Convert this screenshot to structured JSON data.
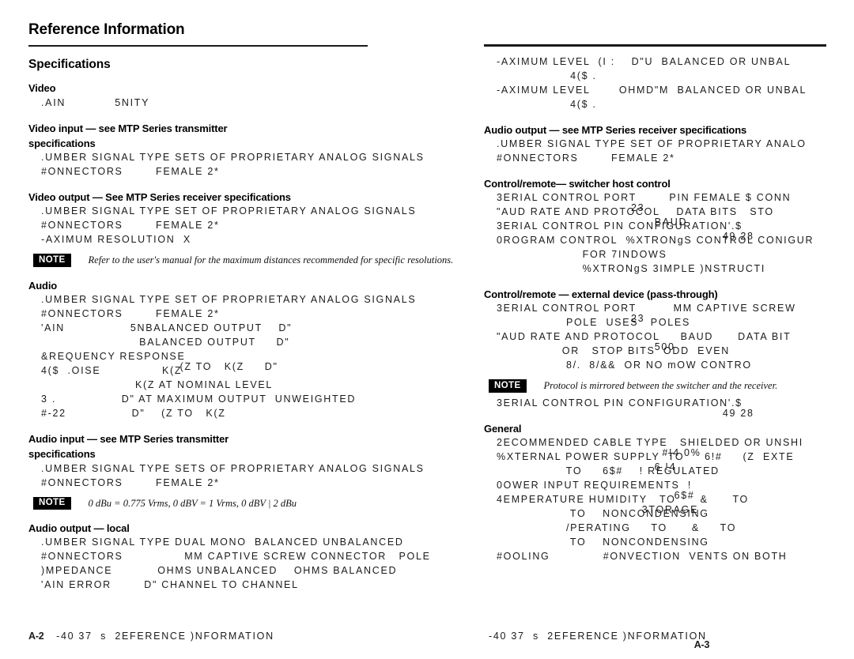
{
  "page": {
    "title": "Reference Information",
    "section_title": "Specifications"
  },
  "left_column": {
    "video": {
      "heading": "Video",
      "rows": [
        {
          "label": ".AIN",
          "value": "5NITY"
        }
      ]
    },
    "video_input": {
      "heading": "Video input — see MTP Series transmitter",
      "heading2": "specifications",
      "rows": [
        {
          "label": ".UMBER SIGNAL TYPE",
          "value": "SETS OF PROPRIETARY ANALOG SIGNALS"
        },
        {
          "label": "#ONNECTORS",
          "value": "FEMALE 2*"
        }
      ]
    },
    "video_output": {
      "heading": "Video output — See MTP Series receiver specifications",
      "rows": [
        {
          "label": ".UMBER SIGNAL TYPE",
          "value": "SET OF PROPRIETARY ANALOG SIGNALS"
        },
        {
          "label": "#ONNECTORS",
          "value": "FEMALE 2*"
        },
        {
          "label": "-AXIMUM RESOLUTION",
          "value": "X"
        }
      ],
      "note": "Refer to the user's manual for the maximum distances recommended for specific resolutions."
    },
    "audio": {
      "heading": "Audio",
      "rows": [
        {
          "label": ".UMBER SIGNAL TYPE",
          "value": "SET OF PROPRIETARY ANALOG SIGNALS"
        },
        {
          "label": "#ONNECTORS",
          "value": "FEMALE 2*"
        },
        {
          "label": "'AIN",
          "value": "5NBALANCED OUTPUT    D\""
        },
        {
          "label": "",
          "value": "BALANCED OUTPUT     D\""
        },
        {
          "label": "&REQUENCY RESPONSE",
          "value": "(Z TO   K(Z     D\""
        },
        {
          "label": "4($  .OISE",
          "value": "K(Z"
        },
        {
          "label": "",
          "value": "K(Z AT NOMINAL LEVEL"
        },
        {
          "label": "3 .",
          "value": "D\" AT MAXIMUM OUTPUT  UNWEIGHTED"
        },
        {
          "label": "#-22",
          "value": "D\"    (Z TO   K(Z"
        }
      ]
    },
    "audio_input": {
      "heading": "Audio input — see MTP Series transmitter",
      "heading2": "specifications",
      "rows": [
        {
          "label": ".UMBER SIGNAL TYPE",
          "value": "SETS OF PROPRIETARY ANALOG SIGNALS"
        },
        {
          "label": "#ONNECTORS",
          "value": "FEMALE 2*"
        }
      ],
      "note": "0 dBu = 0.775 Vrms, 0 dBV = 1 Vrms, 0 dBV | 2 dBu"
    },
    "audio_output_local": {
      "heading": "Audio output — local",
      "rows": [
        {
          "label": ".UMBER SIGNAL TYPE",
          "value": "DUAL MONO  BALANCED UNBALANCED"
        },
        {
          "label": "#ONNECTORS",
          "value": "MM CAPTIVE SCREW CONNECTOR   POLE"
        },
        {
          "label": ")MPEDANCE",
          "value": "OHMS UNBALANCED    OHMS BALANCED"
        },
        {
          "label": "'AIN ERROR",
          "value": "D\" CHANNEL TO CHANNEL"
        }
      ]
    }
  },
  "right_column": {
    "max_level": {
      "rows": [
        {
          "label": "-AXIMUM LEVEL  (I :",
          "value": "D\"U  BALANCED OR UNBAL"
        },
        {
          "label": "",
          "value": "4($ ."
        },
        {
          "label": "-AXIMUM LEVEL",
          "value": "OHMD\"M  BALANCED OR UNBAL"
        },
        {
          "label": "",
          "value": "4($ ."
        }
      ]
    },
    "audio_output_receiver": {
      "heading": "Audio output — see MTP Series receiver specifications",
      "rows": [
        {
          "label": ".UMBER SIGNAL TYPE",
          "value": "SET OF PROPRIETARY ANALO"
        },
        {
          "label": "#ONNECTORS",
          "value": "FEMALE 2*"
        }
      ]
    },
    "control_host": {
      "heading": "Control/remote— switcher host control",
      "rows": [
        {
          "label": "3ERIAL CONTROL PORT",
          "overlap": "23",
          "value": "PIN FEMALE $ CONN"
        },
        {
          "label": "\"AUD RATE AND PROTOCOL",
          "overlap": "BAUD",
          "value": "DATA BITS   STO"
        },
        {
          "label": "3ERIAL CONTROL PIN CONFIGURATION",
          "overlap": "49 28",
          "value": "'.$"
        },
        {
          "label": "0ROGRAM CONTROL",
          "value": "%XTRONgS CONTROL CONIGUR"
        },
        {
          "label": "",
          "value": "FOR 7INDOWS"
        },
        {
          "label": "",
          "value": "%XTRONgS 3IMPLE )NSTRUCTI"
        }
      ]
    },
    "control_external": {
      "heading": "Control/remote — external device (pass-through)",
      "rows": [
        {
          "label": "3ERIAL CONTROL PORT",
          "overlap": "23",
          "value": "MM CAPTIVE SCREW"
        },
        {
          "label": "",
          "value": "POLE  USES   POLES"
        },
        {
          "label": "\"AUD RATE AND PROTOCOL",
          "overlap": "500",
          "value": "BAUD      DATA BIT"
        },
        {
          "label": "",
          "value": "OR   STOP BITS  ODD  EVEN"
        },
        {
          "label": "",
          "value": "8/.  8/&&  OR NO mOW CONTRO"
        }
      ],
      "note": "Protocol is mirrored between the switcher and the receiver.",
      "row_after_note": {
        "label": "3ERIAL CONTROL PIN CONFIGURATION",
        "overlap": "49 28",
        "value": "'.$"
      }
    },
    "general": {
      "heading": "General",
      "rows": [
        {
          "label": "2ECOMMENDED CABLE TYPE",
          "overlap": "#!4 0%",
          "value": "SHIELDED OR UNSHI"
        },
        {
          "label": "%XTERNAL POWER SUPPLY",
          "overlap": "6 !4",
          "value": "TO     6!#     (Z  EXTE"
        },
        {
          "label": "",
          "value": "TO     6$#    ! REGULATED"
        },
        {
          "label": "0OWER INPUT REQUIREMENTS",
          "overlap": "6$#",
          "value": "!"
        },
        {
          "label": "4EMPERATURE HUMIDITY",
          "overlap": "3TORAGE",
          "value": "TO      &      TO"
        },
        {
          "label": "",
          "value": "TO    NONCONDENSING"
        },
        {
          "label": "",
          "value": "/PERATING     TO      &     TO"
        },
        {
          "label": "",
          "value": "TO    NONCONDENSING"
        },
        {
          "label": "#OOLING",
          "value": "#ONVECTION  VENTS ON BOTH"
        }
      ]
    }
  },
  "footer": {
    "left_page": "A-2",
    "left_text": "-40 37  s  2EFERENCE )NFORMATION",
    "right_text": "-40 37  s  2EFERENCE )NFORMATION",
    "right_page": "A-3"
  }
}
